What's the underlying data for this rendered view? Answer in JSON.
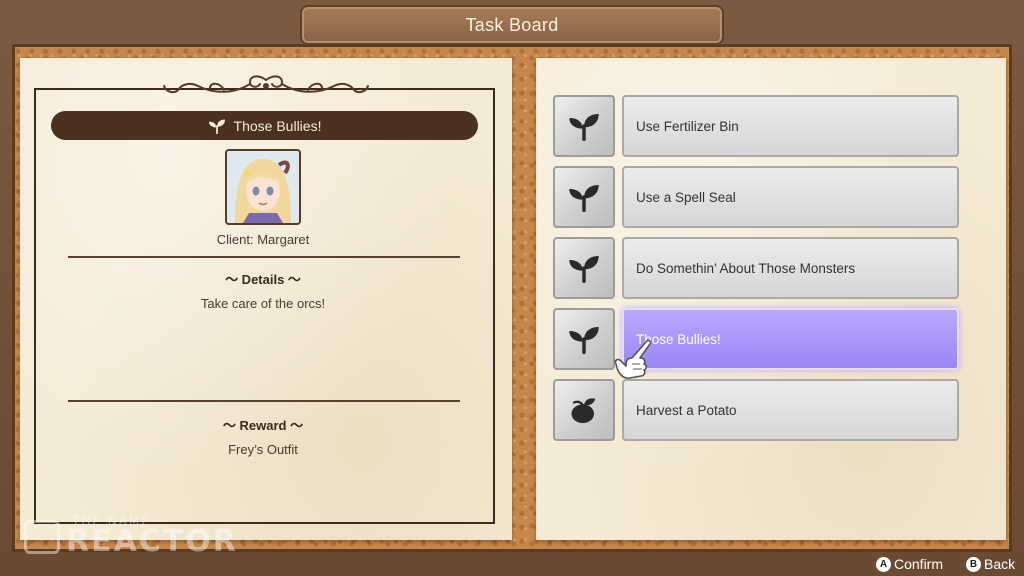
{
  "header": {
    "title": "Task Board"
  },
  "detail": {
    "task_title": "Those Bullies!",
    "client": "Client: Margaret",
    "details_heading": "〜 Details 〜",
    "details_text": "Take care of the orcs!",
    "reward_heading": "〜 Reward 〜",
    "reward_text": "Frey’s Outfit"
  },
  "tasks": [
    {
      "label": "Use Fertilizer Bin",
      "icon": "sprout-icon",
      "selected": false
    },
    {
      "label": "Use a Spell Seal",
      "icon": "sprout-icon",
      "selected": false
    },
    {
      "label": "Do Somethin’ About Those Monsters",
      "icon": "sprout-icon",
      "selected": false
    },
    {
      "label": "Those Bullies!",
      "icon": "sprout-icon",
      "selected": true
    },
    {
      "label": "Harvest a Potato",
      "icon": "potato-icon",
      "selected": false
    }
  ],
  "controls": {
    "confirm_key": "A",
    "confirm_label": "Confirm",
    "back_key": "B",
    "back_label": "Back"
  },
  "watermark": {
    "small": "THE NAME",
    "big": "REACTOR"
  },
  "colors": {
    "cork": "#c8874a",
    "paper": "#f5ead4",
    "title_bar": "#4a3120",
    "selected": "#9b86f5"
  }
}
